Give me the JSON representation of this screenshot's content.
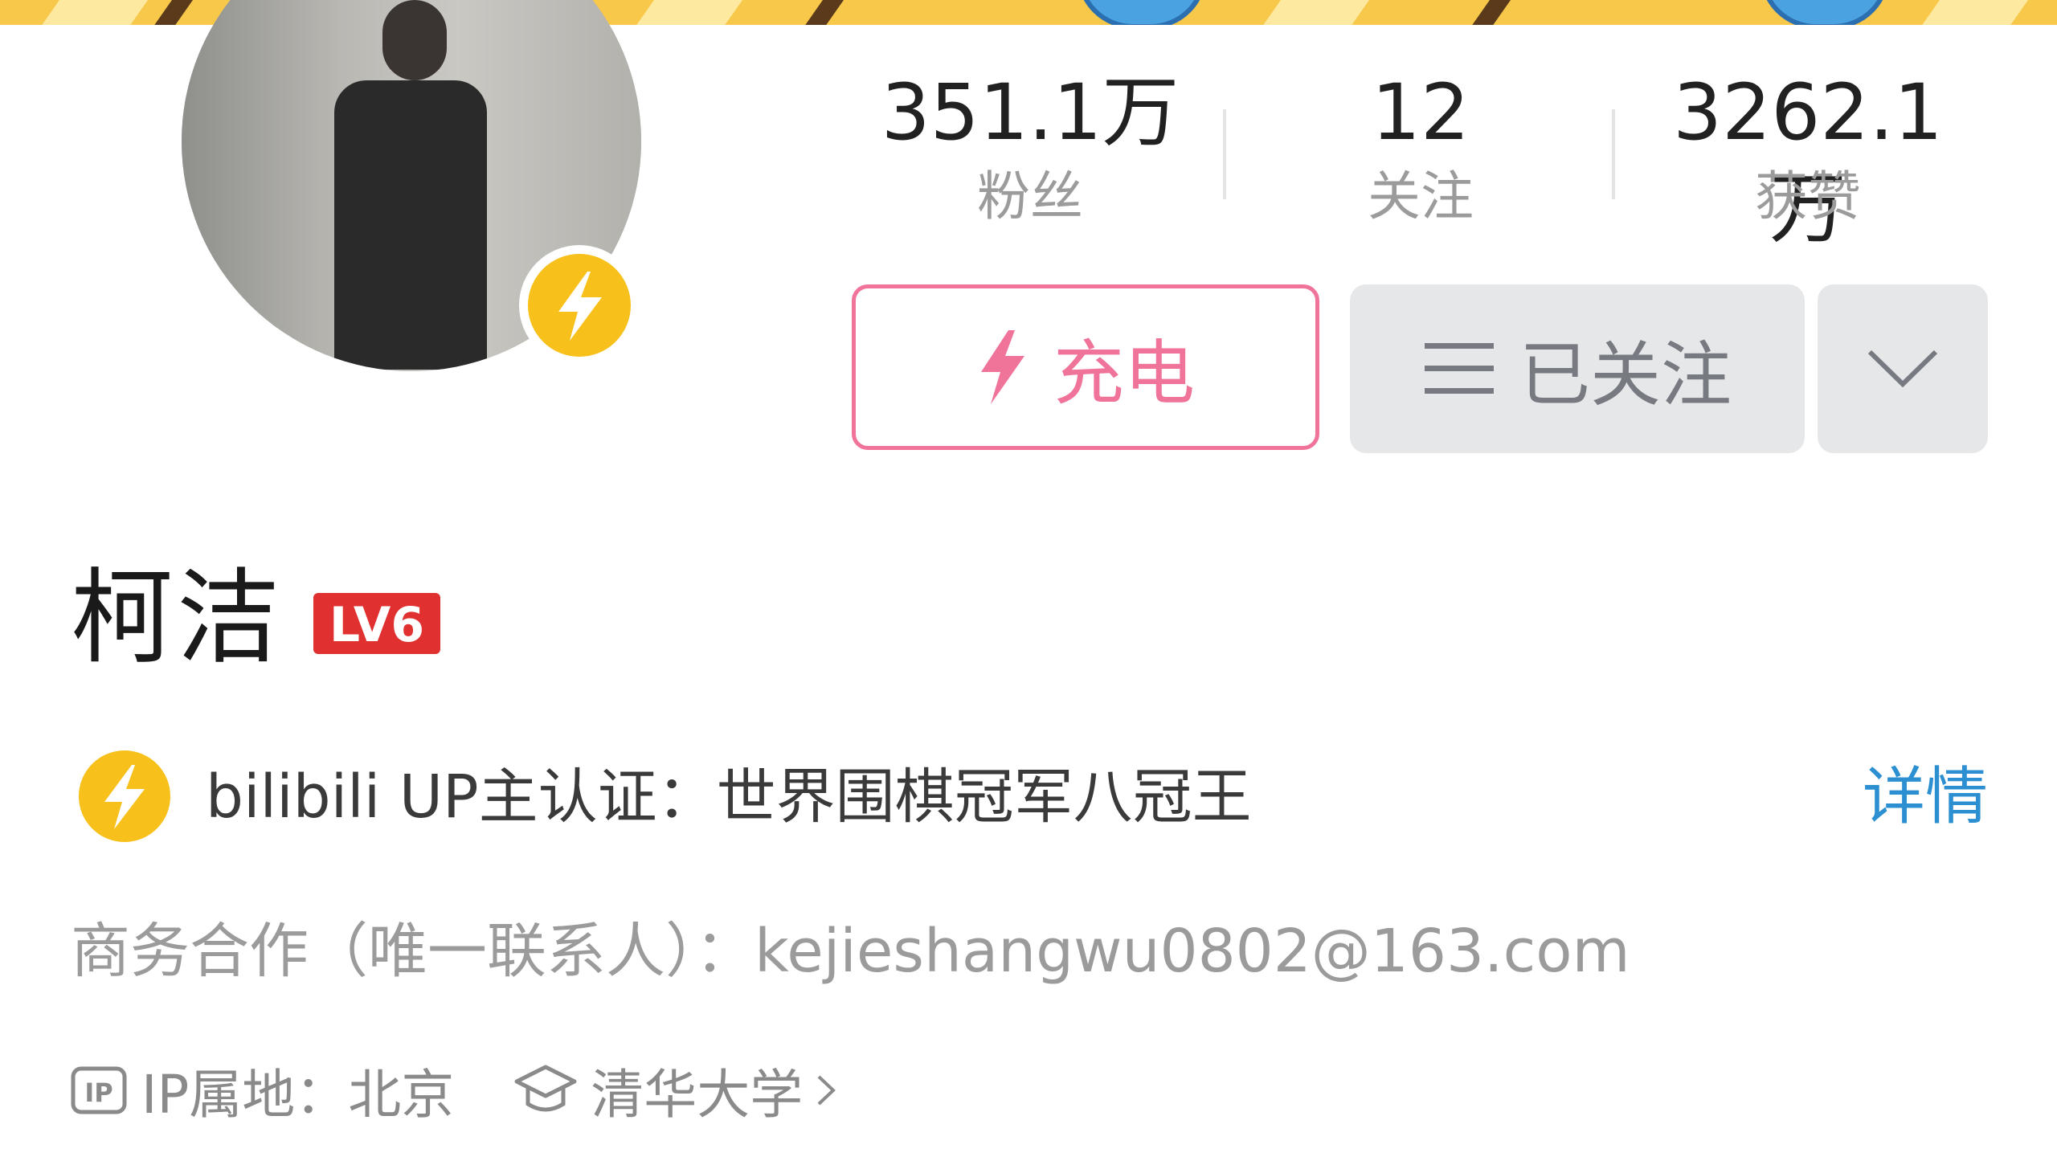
{
  "profile": {
    "name": "柯洁",
    "level_badge": "LV6"
  },
  "stats": [
    {
      "value": "351.1万",
      "label": "粉丝"
    },
    {
      "value": "12",
      "label": "关注"
    },
    {
      "value": "3262.1万",
      "label": "获赞"
    }
  ],
  "actions": {
    "charge_label": "充电",
    "follow_label": "已关注"
  },
  "certification": {
    "text": "bilibili UP主认证：世界围棋冠军八冠王",
    "detail_link": "详情"
  },
  "business": {
    "text": "商务合作（唯一联系人）：kejieshangwu0802@163.com"
  },
  "meta": {
    "ip_location": "IP属地：北京",
    "school": "清华大学"
  },
  "icons": {
    "verify_badge": "lightning-icon",
    "charge": "lightning-icon",
    "follow": "menu-icon",
    "more": "chevron-down-icon",
    "ip": "ip-icon",
    "school": "graduation-cap-icon",
    "school_link": "chevron-right-icon"
  },
  "colors": {
    "pink": "#f0739a",
    "gold": "#f7c01b",
    "link_blue": "#2b8fd1",
    "level_red": "#e03030"
  }
}
